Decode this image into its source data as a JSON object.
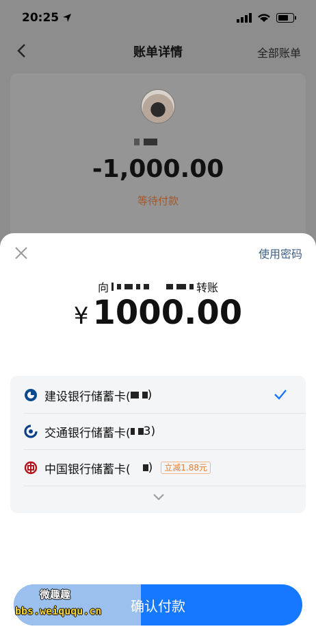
{
  "status_bar": {
    "time": "20:25",
    "icons": [
      "location-arrow-icon",
      "signal-icon",
      "wifi-icon",
      "battery-icon"
    ]
  },
  "nav": {
    "title": "账单详情",
    "right_label": "全部账单",
    "back_icon": "chevron-left-icon"
  },
  "bill": {
    "amount": "-1,000.00",
    "status": "等待付款"
  },
  "sheet": {
    "use_password_label": "使用密码",
    "transfer": {
      "prefix": "向",
      "suffix": "转账"
    },
    "amount_symbol": "¥",
    "amount": "1000.00",
    "cards": [
      {
        "bank_icon": "ccb-bank-icon",
        "name": "建设银行储蓄卡(",
        "tail": ")",
        "selected": true
      },
      {
        "bank_icon": "bocom-bank-icon",
        "name": "交通银行储蓄卡(",
        "tail": "3)",
        "selected": false
      },
      {
        "bank_icon": "boc-bank-icon",
        "name": "中国银行储蓄卡(",
        "tail": ")",
        "promo": "立减1.88元",
        "selected": false
      }
    ],
    "confirm_label": "确认付款"
  },
  "watermark": {
    "top": "微趣趣",
    "bottom": "bbs.weiququ.cn"
  },
  "colors": {
    "accent": "#1677ff",
    "promo": "#e47c2e",
    "status_orange": "#a2582a",
    "link_blue": "#3e5f8a"
  }
}
